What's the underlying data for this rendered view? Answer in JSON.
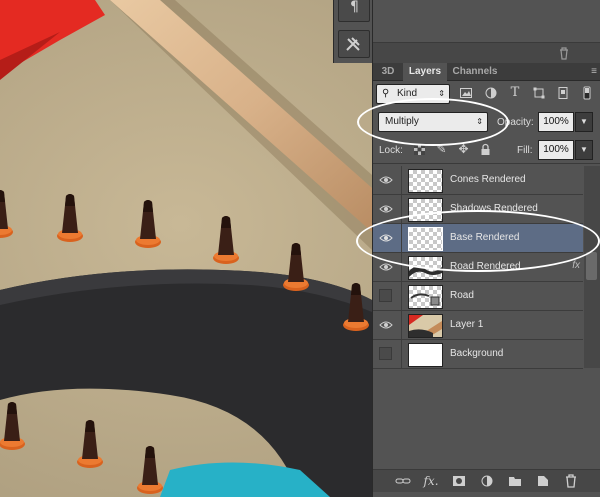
{
  "tabs": [
    {
      "label": "3D"
    },
    {
      "label": "Layers",
      "active": true
    },
    {
      "label": "Channels"
    }
  ],
  "filter": {
    "kind_label": "Kind"
  },
  "blend": {
    "mode": "Multiply",
    "opacity_label": "Opacity:",
    "opacity_value": "100%"
  },
  "lock": {
    "label": "Lock:",
    "fill_label": "Fill:",
    "fill_value": "100%"
  },
  "layers": [
    {
      "name": "Cones Rendered",
      "visible": true,
      "thumb": "checker"
    },
    {
      "name": "Shadows Rendered",
      "visible": true,
      "thumb": "checker"
    },
    {
      "name": "Base Rendered",
      "visible": true,
      "thumb": "checker",
      "selected": true
    },
    {
      "name": "Road Rendered",
      "visible": true,
      "thumb": "road",
      "fx": "fx"
    },
    {
      "name": "Road",
      "visible": false,
      "thumb": "checker-3d"
    },
    {
      "name": "Layer 1",
      "visible": true,
      "thumb": "photo"
    },
    {
      "name": "Background",
      "visible": false,
      "thumb": "white"
    }
  ],
  "colors": {
    "panel_bg": "#535353",
    "selected_row": "#5d6c85",
    "annotation": "#ffffff"
  },
  "icons": [
    "search-icon",
    "image-filter-icon",
    "adjustment-filter-icon",
    "type-filter-icon",
    "shape-filter-icon",
    "smart-object-filter-icon",
    "filter-toggle-icon",
    "lock-transparent-icon",
    "lock-image-icon",
    "lock-position-icon",
    "lock-all-icon",
    "link-icon",
    "fx-icon",
    "mask-icon",
    "adjustment-icon",
    "folder-icon",
    "new-layer-icon",
    "trash-icon"
  ]
}
